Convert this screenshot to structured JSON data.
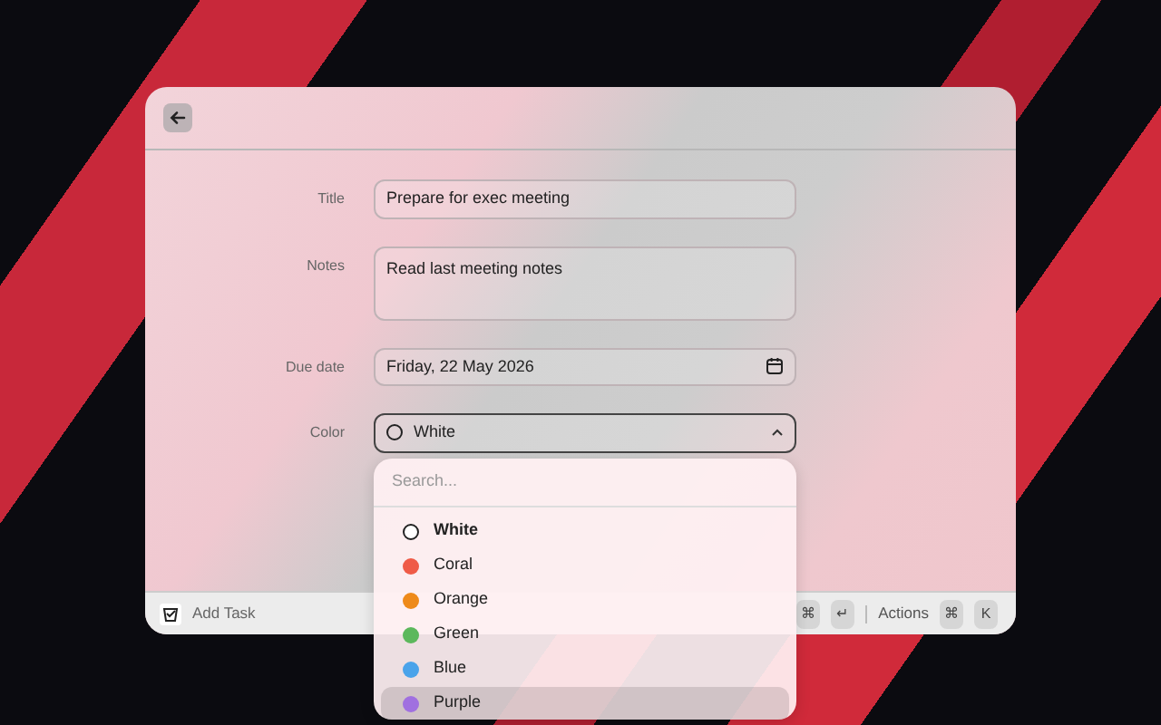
{
  "header": {
    "back_button": true
  },
  "form": {
    "fields": [
      {
        "kind": "text",
        "label": "Title",
        "value": "Prepare for exec meeting"
      },
      {
        "kind": "textarea",
        "label": "Notes",
        "value": "Read last meeting notes"
      },
      {
        "kind": "date",
        "label": "Due date",
        "value": "Friday, 22 May 2026"
      },
      {
        "kind": "select",
        "label": "Color",
        "value": "White",
        "expanded": true
      }
    ]
  },
  "dropdown": {
    "placeholder": "Search...",
    "options": [
      {
        "label": "White",
        "color": "#ffffff",
        "selected": true,
        "highlighted": false
      },
      {
        "label": "Coral",
        "color": "#ef5b47",
        "selected": false,
        "highlighted": false
      },
      {
        "label": "Orange",
        "color": "#ee8a1a",
        "selected": false,
        "highlighted": false
      },
      {
        "label": "Green",
        "color": "#5cb85c",
        "selected": false,
        "highlighted": false
      },
      {
        "label": "Blue",
        "color": "#4aa3ea",
        "selected": false,
        "highlighted": false
      },
      {
        "label": "Purple",
        "color": "#a070e0",
        "selected": false,
        "highlighted": true
      }
    ]
  },
  "footer": {
    "title": "Add Task",
    "primary_keys": [
      "⌘",
      "↵"
    ],
    "actions_label": "Actions",
    "actions_keys": [
      "⌘",
      "K"
    ]
  }
}
